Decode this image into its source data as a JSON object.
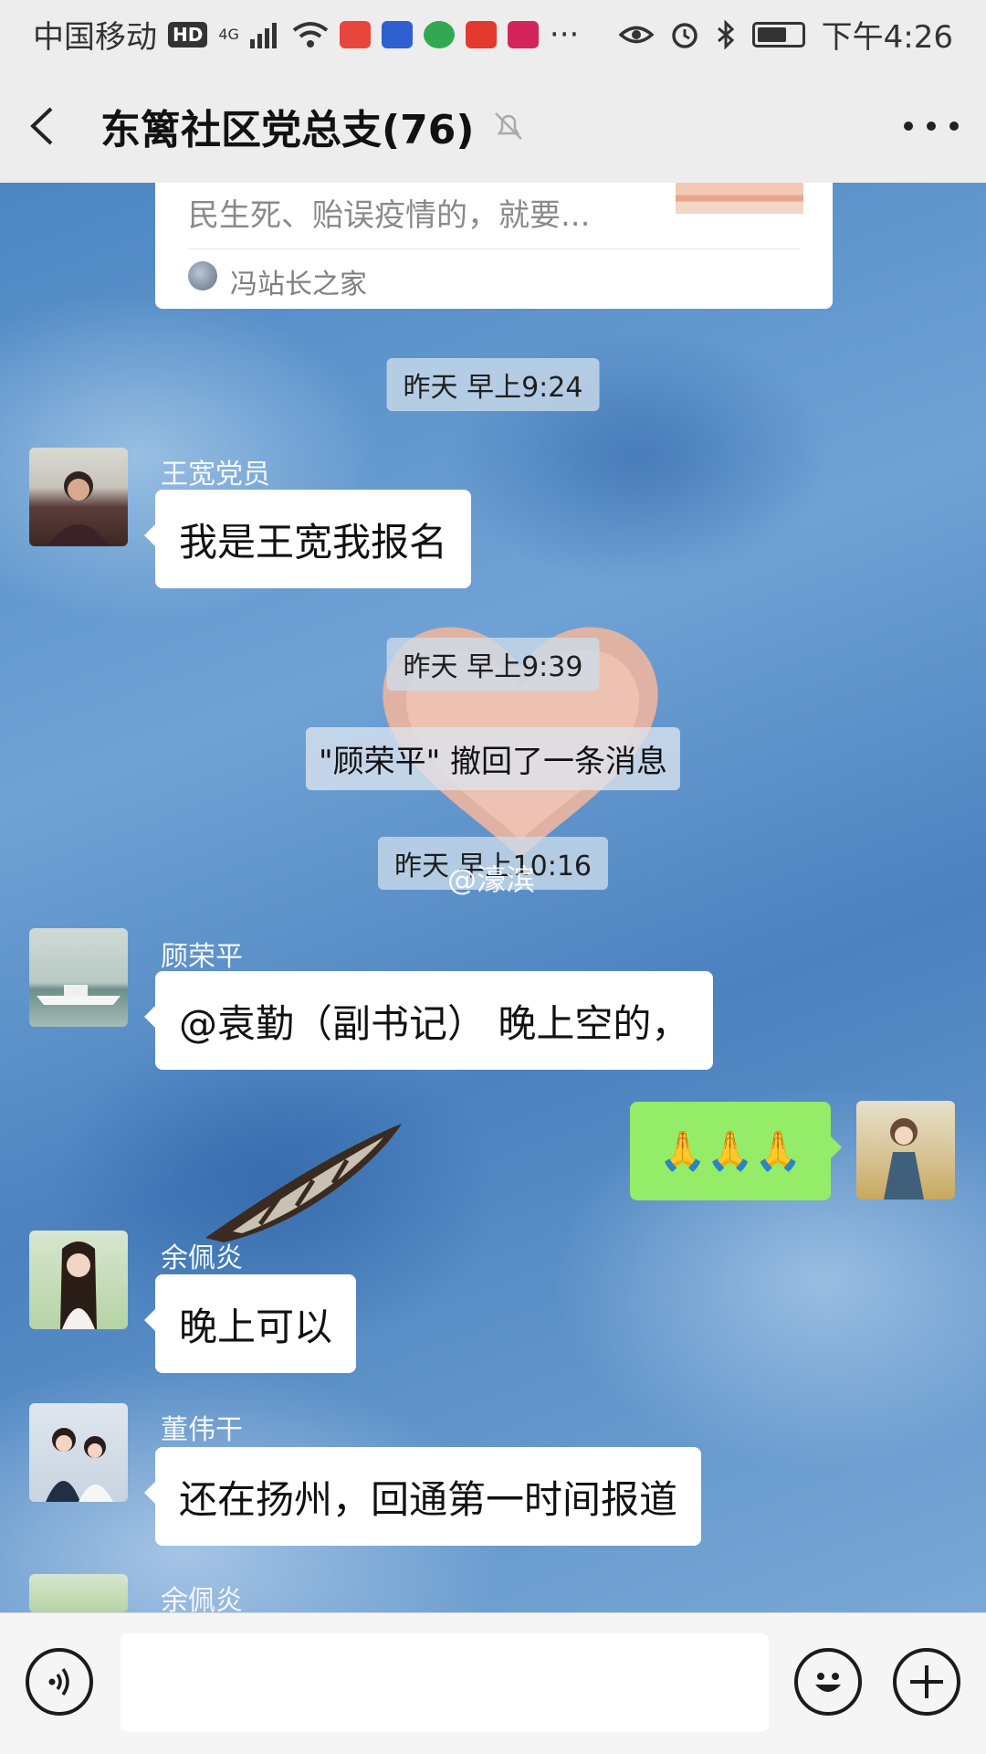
{
  "status_bar": {
    "carrier": "中国移动",
    "hd": "HD",
    "network": "4G",
    "more": "···",
    "time": "下午4:26",
    "battery_level": 0.6,
    "app_icons": [
      "maps-icon",
      "baidu-icon",
      "browser-icon",
      "toutiao-icon",
      "video-icon"
    ]
  },
  "header": {
    "title": "东篱社区党总支(76)"
  },
  "link_card": {
    "preview": "民生死、贻误疫情的，就要...",
    "source": "冯站长之家"
  },
  "messages": {
    "time_1": "昨天 早上9:24",
    "wang_sender": "王宽党员",
    "wang_text": "我是王宽我报名",
    "time_2": "昨天 早上9:39",
    "recall_notice": "\"顾荣平\" 撤回了一条消息",
    "time_3": "昨天 早上10:16",
    "gu_sender": "顾荣平",
    "gu_text": "@袁勤（副书记） 晚上空的，",
    "my_text": "🙏🙏🙏",
    "yu_sender": "余佩炎",
    "yu_text": "晚上可以",
    "dong_sender": "董伟干",
    "dong_text": "还在扬州，回通第一时间报道",
    "yu_sender_2": "余佩炎"
  },
  "watermark": "@濠滨",
  "colors": {
    "my_bubble": "#95ec69",
    "other_bubble": "#ffffff",
    "bar_bg": "#ededed"
  }
}
